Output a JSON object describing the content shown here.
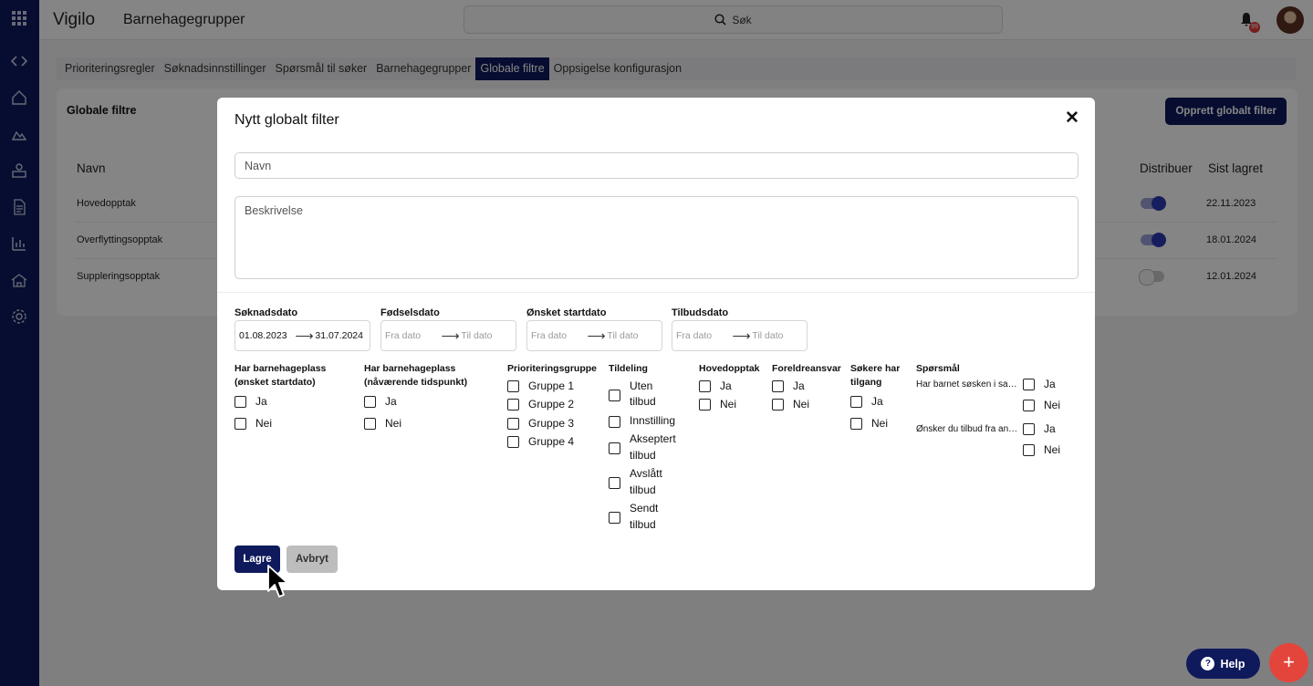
{
  "app": {
    "logo": "Vigilo",
    "page_title": "Barnehagegrupper",
    "search_label": "Søk",
    "notification_count": "99"
  },
  "tabs": [
    {
      "label": "Prioriteringsregler"
    },
    {
      "label": "Søknadsinnstillinger"
    },
    {
      "label": "Spørsmål til søker"
    },
    {
      "label": "Barnehagegrupper"
    },
    {
      "label": "Globale filtre"
    },
    {
      "label": "Oppsigelse konfigurasjon"
    }
  ],
  "card": {
    "title": "Globale filtre",
    "create_button": "Opprett globalt filter",
    "columns": {
      "name": "Navn",
      "distribute": "Distribuer",
      "last_saved": "Sist lagret"
    },
    "rows": [
      {
        "name": "Hovedopptak",
        "distributed": true,
        "date": "22.11.2023"
      },
      {
        "name": "Overflyttingsopptak",
        "distributed": true,
        "date": "18.01.2024"
      },
      {
        "name": "Suppleringsopptak",
        "distributed": false,
        "date": "12.01.2024"
      }
    ]
  },
  "modal": {
    "title": "Nytt globalt filter",
    "name_placeholder": "Navn",
    "description_placeholder": "Beskrivelse",
    "date_filters": [
      {
        "label": "Søknadsdato",
        "from": "01.08.2023",
        "to": "31.07.2024"
      },
      {
        "label": "Fødselsdato",
        "from": "Fra dato",
        "to": "Til dato"
      },
      {
        "label": "Ønsket startdato",
        "from": "Fra dato",
        "to": "Til dato"
      },
      {
        "label": "Tilbudsdato",
        "from": "Fra dato",
        "to": "Til dato"
      }
    ],
    "filters": {
      "has_place_wanted": {
        "label": "Har barnehageplass (ønsket startdato)",
        "options": [
          "Ja",
          "Nei"
        ]
      },
      "has_place_current": {
        "label": "Har barnehageplass (nåværende tidspunkt)",
        "options": [
          "Ja",
          "Nei"
        ]
      },
      "priority_group": {
        "label": "Prioriteringsgruppe",
        "options": [
          "Gruppe 1",
          "Gruppe 2",
          "Gruppe 3",
          "Gruppe 4"
        ]
      },
      "allocation": {
        "label": "Tildeling",
        "options": [
          "Uten tilbud",
          "Innstilling",
          "Akseptert tilbud",
          "Avslått tilbud",
          "Sendt tilbud"
        ]
      },
      "main_intake": {
        "label": "Hovedopptak",
        "options": [
          "Ja",
          "Nei"
        ]
      },
      "parent_response": {
        "label": "Foreldreansvar",
        "options": [
          "Ja",
          "Nei"
        ]
      },
      "applicant_access": {
        "label": "Søkere har tilgang",
        "options": [
          "Ja",
          "Nei"
        ]
      }
    },
    "questions": {
      "label": "Spørsmål",
      "items": [
        {
          "text": "Har barnet søsken i samme barnehage?",
          "options": [
            "Ja",
            "Nei"
          ]
        },
        {
          "text": "Ønsker du tilbud fra andre barnehager?",
          "options": [
            "Ja",
            "Nei"
          ]
        }
      ]
    },
    "save_button": "Lagre",
    "cancel_button": "Avbryt"
  },
  "help_button": "Help",
  "fab_label": "+"
}
